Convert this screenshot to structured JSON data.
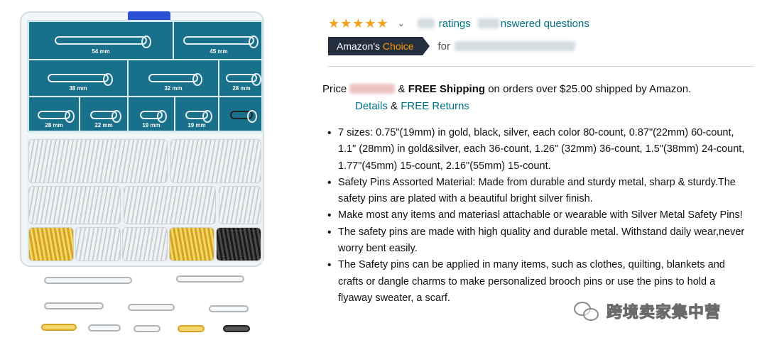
{
  "product_image": {
    "lid_labels": [
      "54 mm",
      "45 mm",
      "38 mm",
      "32 mm",
      "28 mm",
      "28 mm",
      "22 mm",
      "19 mm",
      "19 mm"
    ]
  },
  "rating": {
    "stars": "★★★★★",
    "ratings_suffix": "ratings",
    "questions_suffix": "nswered questions"
  },
  "choice": {
    "brand": "Amazon's",
    "accent": "Choice",
    "for_prefix": "for"
  },
  "price": {
    "label": "Price",
    "amp": "&",
    "free_shipping": "FREE Shipping",
    "shipping_text": "on orders over $25.00 shipped by Amazon.",
    "details_link": "Details",
    "amp2": "&",
    "returns_link": "FREE Returns"
  },
  "bullets": [
    "7 sizes: 0.75\"(19mm) in gold, black, silver, each color 80-count, 0.87\"(22mm) 60-count, 1.1\" (28mm) in gold&silver, each 36-count, 1.26\" (32mm) 36-count, 1.5\"(38mm) 24-count, 1.77\"(45mm) 15-count, 2.16\"(55mm) 15-count.",
    "Safety Pins Assorted Material: Made from durable and sturdy metal, sharp & sturdy.The safety pins are plated with a beautiful bright silver finish.",
    "Make most any items and materiasl attachable or wearable with Silver Metal Safety Pins!",
    "The safety pins are made with high quality and durable metal. Withstand daily wear,never worry bent easily.",
    "The Safety pins can be applied in many items, such as clothes, quilting, blankets and crafts or dangle charms to make personalized brooch pins or use the pins to hold a flyaway sweater, a scarf."
  ],
  "watermark": {
    "text": "跨境卖家集中营"
  },
  "colors": {
    "link": "#007185",
    "star": "#f3a21d",
    "badge_bg": "#232f3e",
    "badge_accent": "#ff9900",
    "lid": "#18708a"
  }
}
